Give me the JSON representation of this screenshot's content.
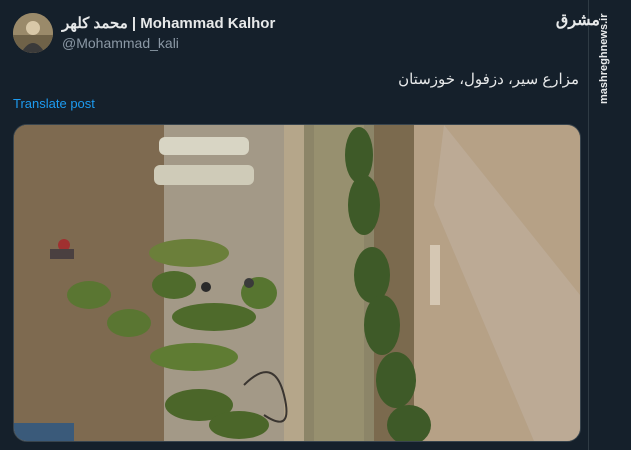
{
  "post": {
    "author_name": "محمد کلهر | Mohammad Kalhor",
    "author_handle": "@Mohammad_kali",
    "text": "مزارع سیر، دزفول، خوزستان",
    "translate_label": "Translate post"
  },
  "watermark": {
    "logo_text": "مشرق",
    "site": "mashreghnews.ir"
  },
  "colors": {
    "background": "#15202b",
    "primary_text": "#e7e9ea",
    "secondary_text": "#8b98a5",
    "link": "#1d9bf0"
  }
}
